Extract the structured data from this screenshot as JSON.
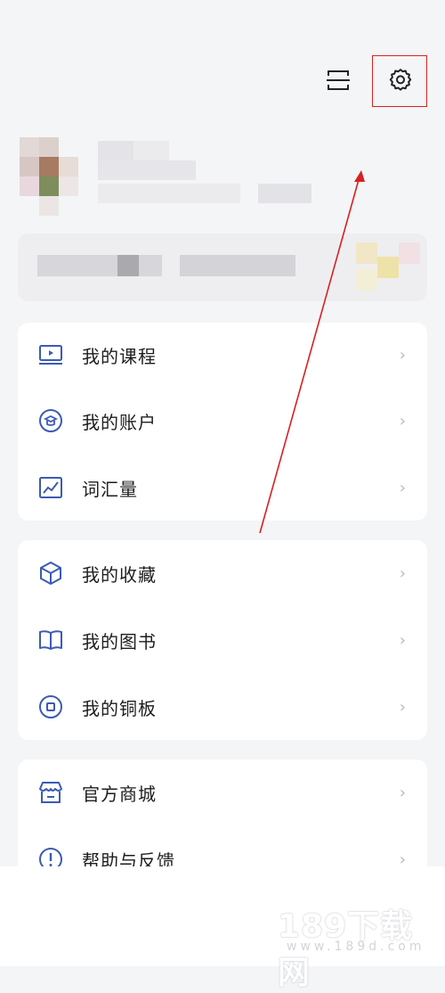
{
  "topbar": {
    "scan_icon": "scan-icon",
    "settings_icon": "gear-icon"
  },
  "menu_group1": [
    {
      "label": "我的课程",
      "icon": "course-play-icon"
    },
    {
      "label": "我的账户",
      "icon": "account-coin-icon"
    },
    {
      "label": "词汇量",
      "icon": "vocabulary-chart-icon"
    }
  ],
  "menu_group2": [
    {
      "label": "我的收藏",
      "icon": "favorites-cube-icon"
    },
    {
      "label": "我的图书",
      "icon": "book-icon"
    },
    {
      "label": "我的铜板",
      "icon": "copper-coin-icon"
    }
  ],
  "menu_group3": [
    {
      "label": "官方商城",
      "icon": "store-icon"
    },
    {
      "label": "帮助与反馈",
      "icon": "help-feedback-icon"
    }
  ],
  "chevron": "›",
  "watermark": {
    "text": "189下载网",
    "sub": "www.189d.com"
  },
  "colors": {
    "icon_blue": "#3b5bb5",
    "highlight_red": "#d82020"
  }
}
